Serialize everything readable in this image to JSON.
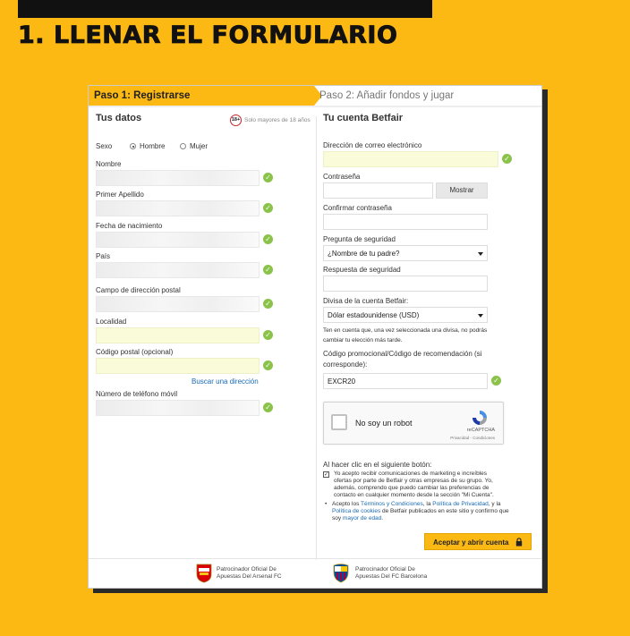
{
  "headline": "1. LLENAR EL FORMULARIO",
  "steps": {
    "step1": "Paso 1: Registrarse",
    "step2": "Paso 2: Añadir fondos y jugar"
  },
  "left": {
    "title": "Tus datos",
    "age_badge": "18+",
    "age_note": "Solo mayores de 18 años",
    "sexo_label": "Sexo",
    "hombre": "Hombre",
    "mujer": "Mujer",
    "nombre": "Nombre",
    "primer_apellido": "Primer Apellido",
    "fecha_nacimiento": "Fecha de nacimiento",
    "pais": "País",
    "direccion": "Campo de dirección postal",
    "localidad": "Localidad",
    "codigo_postal": "Código postal (opcional)",
    "buscar": "Buscar una dirección",
    "telefono": "Número de teléfono móvil"
  },
  "right": {
    "title": "Tu cuenta Betfair",
    "email": "Dirección de correo electrónico",
    "contrasena": "Contraseña",
    "mostrar": "Mostrar",
    "confirmar": "Confirmar contraseña",
    "pregunta": "Pregunta de seguridad",
    "pregunta_value": "¿Nombre de tu padre?",
    "respuesta": "Respuesta de seguridad",
    "divisa": "Divisa de la cuenta Betfair:",
    "divisa_value": "Dólar estadounidense (USD)",
    "divisa_note_1": "Ten en cuenta que, una vez seleccionada una divisa, no podrás",
    "divisa_note_2": "cambiar tu elección más tarde.",
    "promo_1": "Código promocional/Código de recomendación (si",
    "promo_2": "corresponde):",
    "promo_value": "EXCR20",
    "captcha_label": "No soy un robot",
    "captcha_brand": "reCAPTCHA",
    "captcha_terms": "Privacidad - Condiciones",
    "al_hacer": "Al hacer clic en el siguiente botón:",
    "marketing_1": "Yo acepto recibir comunicaciones de marketing e increíbles",
    "marketing_2": "ofertas por parte de Betfair y otras empresas de su grupo. Yo,",
    "marketing_3": "además, comprendo que puedo cambiar las preferencias de",
    "marketing_4": "contacto en cualquier momento desde la sección \"Mi Cuenta\".",
    "terms_a": "Acepto los ",
    "terms_link1": "Términos y Condiciones",
    "terms_b": ", la ",
    "terms_link2": "Política de Privacidad",
    "terms_c": ", y la",
    "terms_link3": "Política de cookies",
    "terms_d": " de Betfair publicados en este sitio y confirmo que",
    "terms_e": "soy ",
    "terms_link4": "mayor de edad",
    "terms_f": ".",
    "accept": "Aceptar y abrir cuenta"
  },
  "footer": {
    "arsenal_1": "Patrocinador Oficial De",
    "arsenal_2": "Apuestas Del Arsenal FC",
    "barca_1": "Patrocinador Oficial De",
    "barca_2": "Apuestas Del FC Barcelona"
  },
  "colors": {
    "brand": "#FDB913",
    "valid": "#8bc34a",
    "link": "#1a6bb5"
  }
}
